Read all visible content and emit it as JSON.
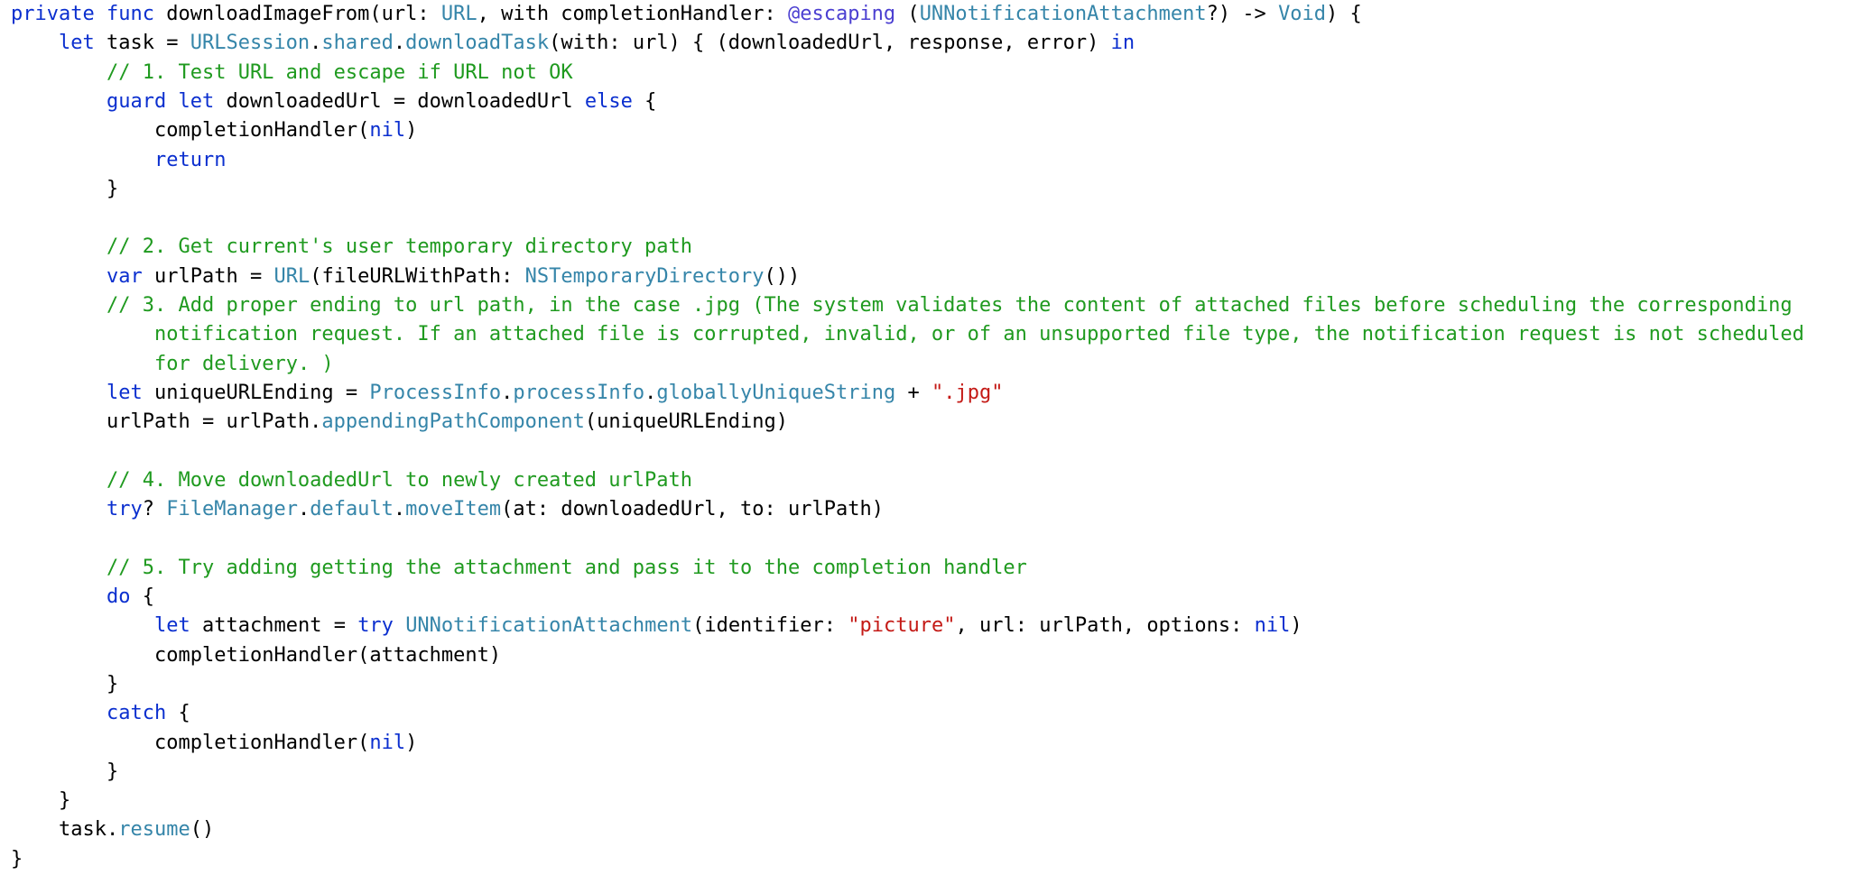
{
  "editor": {
    "language": "Swift",
    "colors": {
      "background": "#ffffff",
      "plain": "#000000",
      "keyword": "#0b2fcf",
      "type": "#3585a9",
      "method": "#3585a9",
      "string": "#c41a16",
      "comment": "#1f9a1f",
      "attribute": "#4b3fd1"
    },
    "lines": [
      {
        "indent": 0,
        "tokens": [
          [
            "keyword",
            "private"
          ],
          [
            "plain",
            " "
          ],
          [
            "keyword",
            "func"
          ],
          [
            "plain",
            " downloadImageFrom(url: "
          ],
          [
            "type",
            "URL"
          ],
          [
            "plain",
            ", with completionHandler: "
          ],
          [
            "attr",
            "@escaping"
          ],
          [
            "plain",
            " ("
          ],
          [
            "type",
            "UNNotificationAttachment"
          ],
          [
            "plain",
            "?) -> "
          ],
          [
            "type",
            "Void"
          ],
          [
            "plain",
            ") {"
          ]
        ]
      },
      {
        "indent": 4,
        "tokens": [
          [
            "keyword",
            "let"
          ],
          [
            "plain",
            " task = "
          ],
          [
            "type",
            "URLSession"
          ],
          [
            "plain",
            "."
          ],
          [
            "method",
            "shared"
          ],
          [
            "plain",
            "."
          ],
          [
            "method",
            "downloadTask"
          ],
          [
            "plain",
            "(with: url) { (downloadedUrl, response, error) "
          ],
          [
            "keyword",
            "in"
          ]
        ]
      },
      {
        "indent": 8,
        "tokens": [
          [
            "comment",
            "// 1. Test URL and escape if URL not OK"
          ]
        ]
      },
      {
        "indent": 8,
        "tokens": [
          [
            "keyword",
            "guard"
          ],
          [
            "plain",
            " "
          ],
          [
            "keyword",
            "let"
          ],
          [
            "plain",
            " downloadedUrl = downloadedUrl "
          ],
          [
            "keyword",
            "else"
          ],
          [
            "plain",
            " {"
          ]
        ]
      },
      {
        "indent": 12,
        "tokens": [
          [
            "plain",
            "completionHandler("
          ],
          [
            "keyword",
            "nil"
          ],
          [
            "plain",
            ")"
          ]
        ]
      },
      {
        "indent": 12,
        "tokens": [
          [
            "keyword",
            "return"
          ]
        ]
      },
      {
        "indent": 8,
        "tokens": [
          [
            "plain",
            "}"
          ]
        ]
      },
      {
        "indent": 0,
        "tokens": []
      },
      {
        "indent": 8,
        "tokens": [
          [
            "comment",
            "// 2. Get current's user temporary directory path"
          ]
        ]
      },
      {
        "indent": 8,
        "tokens": [
          [
            "keyword",
            "var"
          ],
          [
            "plain",
            " urlPath = "
          ],
          [
            "type",
            "URL"
          ],
          [
            "plain",
            "(fileURLWithPath: "
          ],
          [
            "method",
            "NSTemporaryDirectory"
          ],
          [
            "plain",
            "())"
          ]
        ]
      },
      {
        "indent": 8,
        "tokens": [
          [
            "comment",
            "// 3. Add proper ending to url path, in the case .jpg (The system validates the content of attached files before scheduling the corresponding"
          ]
        ]
      },
      {
        "indent": 12,
        "tokens": [
          [
            "comment",
            "notification request. If an attached file is corrupted, invalid, or of an unsupported file type, the notification request is not scheduled"
          ]
        ]
      },
      {
        "indent": 12,
        "tokens": [
          [
            "comment",
            "for delivery. )"
          ]
        ]
      },
      {
        "indent": 8,
        "tokens": [
          [
            "keyword",
            "let"
          ],
          [
            "plain",
            " uniqueURLEnding = "
          ],
          [
            "type",
            "ProcessInfo"
          ],
          [
            "plain",
            "."
          ],
          [
            "method",
            "processInfo"
          ],
          [
            "plain",
            "."
          ],
          [
            "method",
            "globallyUniqueString"
          ],
          [
            "plain",
            " + "
          ],
          [
            "string",
            "\".jpg\""
          ]
        ]
      },
      {
        "indent": 8,
        "tokens": [
          [
            "plain",
            "urlPath = urlPath."
          ],
          [
            "method",
            "appendingPathComponent"
          ],
          [
            "plain",
            "(uniqueURLEnding)"
          ]
        ]
      },
      {
        "indent": 0,
        "tokens": []
      },
      {
        "indent": 8,
        "tokens": [
          [
            "comment",
            "// 4. Move downloadedUrl to newly created urlPath"
          ]
        ]
      },
      {
        "indent": 8,
        "tokens": [
          [
            "keyword",
            "try"
          ],
          [
            "plain",
            "? "
          ],
          [
            "type",
            "FileManager"
          ],
          [
            "plain",
            "."
          ],
          [
            "method",
            "default"
          ],
          [
            "plain",
            "."
          ],
          [
            "method",
            "moveItem"
          ],
          [
            "plain",
            "(at: downloadedUrl, to: urlPath)"
          ]
        ]
      },
      {
        "indent": 0,
        "tokens": []
      },
      {
        "indent": 8,
        "tokens": [
          [
            "comment",
            "// 5. Try adding getting the attachment and pass it to the completion handler"
          ]
        ]
      },
      {
        "indent": 8,
        "tokens": [
          [
            "keyword",
            "do"
          ],
          [
            "plain",
            " {"
          ]
        ]
      },
      {
        "indent": 12,
        "tokens": [
          [
            "keyword",
            "let"
          ],
          [
            "plain",
            " attachment = "
          ],
          [
            "keyword",
            "try"
          ],
          [
            "plain",
            " "
          ],
          [
            "type",
            "UNNotificationAttachment"
          ],
          [
            "plain",
            "(identifier: "
          ],
          [
            "string",
            "\"picture\""
          ],
          [
            "plain",
            ", url: urlPath, options: "
          ],
          [
            "keyword",
            "nil"
          ],
          [
            "plain",
            ")"
          ]
        ]
      },
      {
        "indent": 12,
        "tokens": [
          [
            "plain",
            "completionHandler(attachment)"
          ]
        ]
      },
      {
        "indent": 8,
        "tokens": [
          [
            "plain",
            "}"
          ]
        ]
      },
      {
        "indent": 8,
        "tokens": [
          [
            "keyword",
            "catch"
          ],
          [
            "plain",
            " {"
          ]
        ]
      },
      {
        "indent": 12,
        "tokens": [
          [
            "plain",
            "completionHandler("
          ],
          [
            "keyword",
            "nil"
          ],
          [
            "plain",
            ")"
          ]
        ]
      },
      {
        "indent": 8,
        "tokens": [
          [
            "plain",
            "}"
          ]
        ]
      },
      {
        "indent": 4,
        "tokens": [
          [
            "plain",
            "}"
          ]
        ]
      },
      {
        "indent": 4,
        "tokens": [
          [
            "plain",
            "task."
          ],
          [
            "method",
            "resume"
          ],
          [
            "plain",
            "()"
          ]
        ]
      },
      {
        "indent": 0,
        "tokens": [
          [
            "plain",
            "}"
          ]
        ]
      }
    ]
  }
}
